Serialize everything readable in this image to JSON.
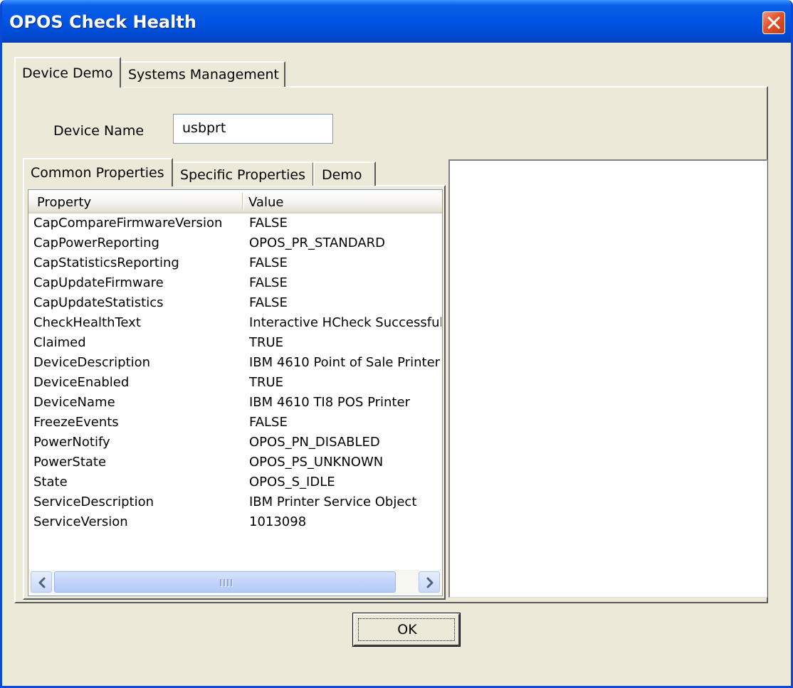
{
  "window": {
    "title": "OPOS Check Health",
    "close_icon": "close-icon"
  },
  "tabs": [
    {
      "label": "Device Demo",
      "selected": true
    },
    {
      "label": "Systems Management",
      "selected": false
    }
  ],
  "device": {
    "name_label": "Device Name",
    "name_value": "usbprt"
  },
  "sub_tabs": [
    {
      "label": "Common Properties",
      "selected": true
    },
    {
      "label": "Specific Properties",
      "selected": false
    },
    {
      "label": "Demo",
      "selected": false
    }
  ],
  "properties_table": {
    "columns": [
      "Property",
      "Value"
    ],
    "rows": [
      [
        "CapCompareFirmwareVersion",
        "FALSE"
      ],
      [
        "CapPowerReporting",
        "OPOS_PR_STANDARD"
      ],
      [
        "CapStatisticsReporting",
        "FALSE"
      ],
      [
        "CapUpdateFirmware",
        "FALSE"
      ],
      [
        "CapUpdateStatistics",
        "FALSE"
      ],
      [
        "CheckHealthText",
        "Interactive HCheck Successful"
      ],
      [
        "Claimed",
        "TRUE"
      ],
      [
        "DeviceDescription",
        "IBM 4610 Point of Sale Printer"
      ],
      [
        "DeviceEnabled",
        "TRUE"
      ],
      [
        "DeviceName",
        "IBM 4610 TI8 POS Printer"
      ],
      [
        "FreezeEvents",
        "FALSE"
      ],
      [
        "PowerNotify",
        "OPOS_PN_DISABLED"
      ],
      [
        "PowerState",
        "OPOS_PS_UNKNOWN"
      ],
      [
        "State",
        "OPOS_S_IDLE"
      ],
      [
        "ServiceDescription",
        "IBM Printer Service Object"
      ],
      [
        "ServiceVersion",
        "1013098"
      ]
    ]
  },
  "scrollbar": {
    "left_icon": "chevron-left-icon",
    "right_icon": "chevron-right-icon"
  },
  "ok_button": {
    "label": "OK"
  },
  "colors": {
    "title_bar": "#0054e3",
    "window_face": "#ece9d8",
    "close_button": "#e2512c",
    "listview_border": "#7f9db9"
  }
}
